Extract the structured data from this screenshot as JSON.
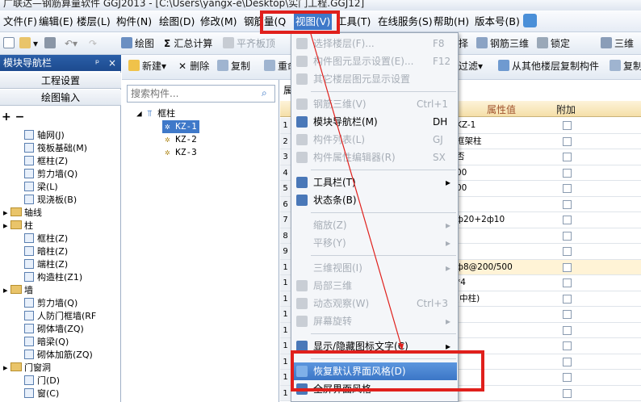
{
  "title_bar": {
    "text": "广联达—钢筋算量软件 GGJ2013 - [C:\\Users\\yangx-e\\Desktop\\实门工程.GGJ12]"
  },
  "menu": {
    "items": [
      "文件(F)",
      "编辑(E)",
      "楼层(L)",
      "构件(N)",
      "绘图(D)",
      "修改(M)",
      "钢筋量(Q)",
      "视图(V)",
      "工具(T)",
      "在线服务(S)",
      "帮助(H)",
      "版本号(B)"
    ]
  },
  "toolbar1": {
    "draw": "绘图",
    "sum": "汇总计算",
    "flat_roof": "平齐板顶",
    "select": "择",
    "rebar3d": "钢筋三维",
    "lock": "锁定",
    "three": "三维"
  },
  "left_panel": {
    "title": "模块导航栏",
    "pin": "ᵖ",
    "close": "×",
    "btn_project": "工程设置",
    "btn_draw": "绘图输入",
    "tree": [
      {
        "label": "轴网(J)",
        "indent": 2
      },
      {
        "label": "筏板基础(M)",
        "indent": 2
      },
      {
        "label": "框柱(Z)",
        "indent": 2
      },
      {
        "label": "剪力墙(Q)",
        "indent": 2
      },
      {
        "label": "梁(L)",
        "indent": 2
      },
      {
        "label": "现浇板(B)",
        "indent": 2
      },
      {
        "label": "轴线",
        "indent": 1
      },
      {
        "label": "柱",
        "indent": 1
      },
      {
        "label": "框柱(Z)",
        "indent": 2
      },
      {
        "label": "暗柱(Z)",
        "indent": 2
      },
      {
        "label": "端柱(Z)",
        "indent": 2
      },
      {
        "label": "构造柱(Z1)",
        "indent": 2
      },
      {
        "label": "墙",
        "indent": 1
      },
      {
        "label": "剪力墙(Q)",
        "indent": 2
      },
      {
        "label": "人防门框墙(RF",
        "indent": 2
      },
      {
        "label": "砌体墙(ZQ)",
        "indent": 2
      },
      {
        "label": "暗梁(Q)",
        "indent": 2
      },
      {
        "label": "砌体加筋(ZQ)",
        "indent": 2
      },
      {
        "label": "门窗洞",
        "indent": 1
      },
      {
        "label": "门(D)",
        "indent": 2
      },
      {
        "label": "窗(C)",
        "indent": 2
      }
    ]
  },
  "toolbar2": {
    "new": "新建",
    "delete": "删除",
    "copy": "复制",
    "rename": "重命",
    "filter": "过滤",
    "copy_from_floor": "从其他楼层复制构件",
    "copy2": "复制"
  },
  "mid_panel": {
    "search_placeholder": "搜索构件...",
    "tree_root": "框柱",
    "items": [
      "KZ-1",
      "KZ-2",
      "KZ-3"
    ]
  },
  "right_panel": {
    "tab": "属",
    "col_value": "属性值",
    "col_attach": "附加",
    "rows": [
      {
        "n": "1",
        "v": "KZ-1"
      },
      {
        "n": "2",
        "v": "框架柱"
      },
      {
        "n": "3",
        "v": "否"
      },
      {
        "n": "4",
        "v": "00"
      },
      {
        "n": "5",
        "v": "00"
      },
      {
        "n": "6",
        "v": ""
      },
      {
        "n": "7",
        "v": "ф20+2ф10"
      },
      {
        "n": "8",
        "v": ""
      },
      {
        "n": "9",
        "v": ""
      },
      {
        "n": "1",
        "v": "ф8@200/500"
      },
      {
        "n": "1",
        "v": "*4"
      },
      {
        "n": "1",
        "v": "(中柱)"
      },
      {
        "n": "1",
        "v": ""
      },
      {
        "n": "1",
        "v": ""
      },
      {
        "n": "1",
        "v": ""
      },
      {
        "n": "1",
        "v": ""
      },
      {
        "n": "1",
        "v": ""
      },
      {
        "n": "1",
        "v": ""
      }
    ]
  },
  "view_menu": {
    "items": [
      {
        "label": "选择楼层(F)...",
        "shortcut": "F8",
        "disabled": true,
        "icon": true
      },
      {
        "label": "构件图元显示设置(E)...",
        "shortcut": "F12",
        "disabled": true,
        "icon": true
      },
      {
        "label": "其它楼层图元显示设置",
        "shortcut": "",
        "disabled": true,
        "icon": true
      },
      {
        "sep": true
      },
      {
        "label": "钢筋三维(V)",
        "shortcut": "Ctrl+1",
        "disabled": true,
        "icon": true
      },
      {
        "label": "模块导航栏(M)",
        "shortcut": "DH",
        "disabled": false,
        "icon": true
      },
      {
        "label": "构件列表(L)",
        "shortcut": "GJ",
        "disabled": true,
        "icon": true
      },
      {
        "label": "构件属性编辑器(R)",
        "shortcut": "SX",
        "disabled": true,
        "icon": true
      },
      {
        "sep": true
      },
      {
        "label": "工具栏(T)",
        "shortcut": "",
        "disabled": false,
        "icon": true,
        "arrow": true
      },
      {
        "label": "状态条(B)",
        "shortcut": "",
        "disabled": false,
        "icon": true
      },
      {
        "sep": true
      },
      {
        "label": "缩放(Z)",
        "shortcut": "",
        "disabled": true,
        "arrow": true
      },
      {
        "label": "平移(Y)",
        "shortcut": "",
        "disabled": true,
        "arrow": true
      },
      {
        "sep": true
      },
      {
        "label": "三维视图(I)",
        "shortcut": "",
        "disabled": true,
        "arrow": true
      },
      {
        "label": "局部三维",
        "shortcut": "",
        "disabled": true,
        "icon": true
      },
      {
        "label": "动态观察(W)",
        "shortcut": "Ctrl+3",
        "disabled": true,
        "icon": true
      },
      {
        "label": "屏幕旋转",
        "shortcut": "",
        "disabled": true,
        "icon": true,
        "arrow": true
      },
      {
        "sep": true
      },
      {
        "label": "显示/隐藏图标文字(C)",
        "shortcut": "",
        "disabled": false,
        "icon": true,
        "arrow": true
      },
      {
        "sep": true
      },
      {
        "label": "恢复默认界面风格(D)",
        "shortcut": "",
        "disabled": false,
        "icon": true,
        "highlighted": true
      },
      {
        "label": "全屏界面风格",
        "shortcut": "",
        "disabled": false,
        "icon": true
      }
    ]
  },
  "colors": {
    "accent": "#3f79c9",
    "annotation_red": "#e0201c",
    "nav_title": "#2a5fa8"
  }
}
